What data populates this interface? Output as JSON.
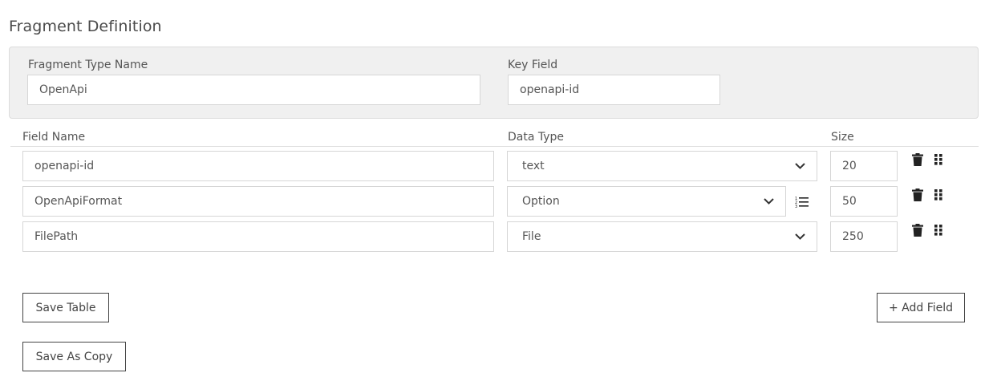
{
  "section_title": "Fragment Definition",
  "header": {
    "type_name_label": "Fragment Type Name",
    "type_name_value": "OpenApi",
    "key_field_label": "Key Field",
    "key_field_value": "openapi-id"
  },
  "columns": {
    "field_name": "Field Name",
    "data_type": "Data Type",
    "size": "Size"
  },
  "rows": [
    {
      "field_name": "openapi-id",
      "data_type": "text",
      "size": "20",
      "options_icon": false
    },
    {
      "field_name": "OpenApiFormat",
      "data_type": "Option",
      "size": "50",
      "options_icon": true
    },
    {
      "field_name": "FilePath",
      "data_type": "File",
      "size": "250",
      "options_icon": false
    }
  ],
  "icons": {
    "delete": "trash-icon",
    "drag": "drag-handle-icon",
    "dropdown": "chevron-down-icon",
    "options": "list-icon"
  },
  "buttons": {
    "save_table": "Save Table",
    "add_field": "+ Add Field",
    "save_as_copy": "Save As Copy"
  }
}
